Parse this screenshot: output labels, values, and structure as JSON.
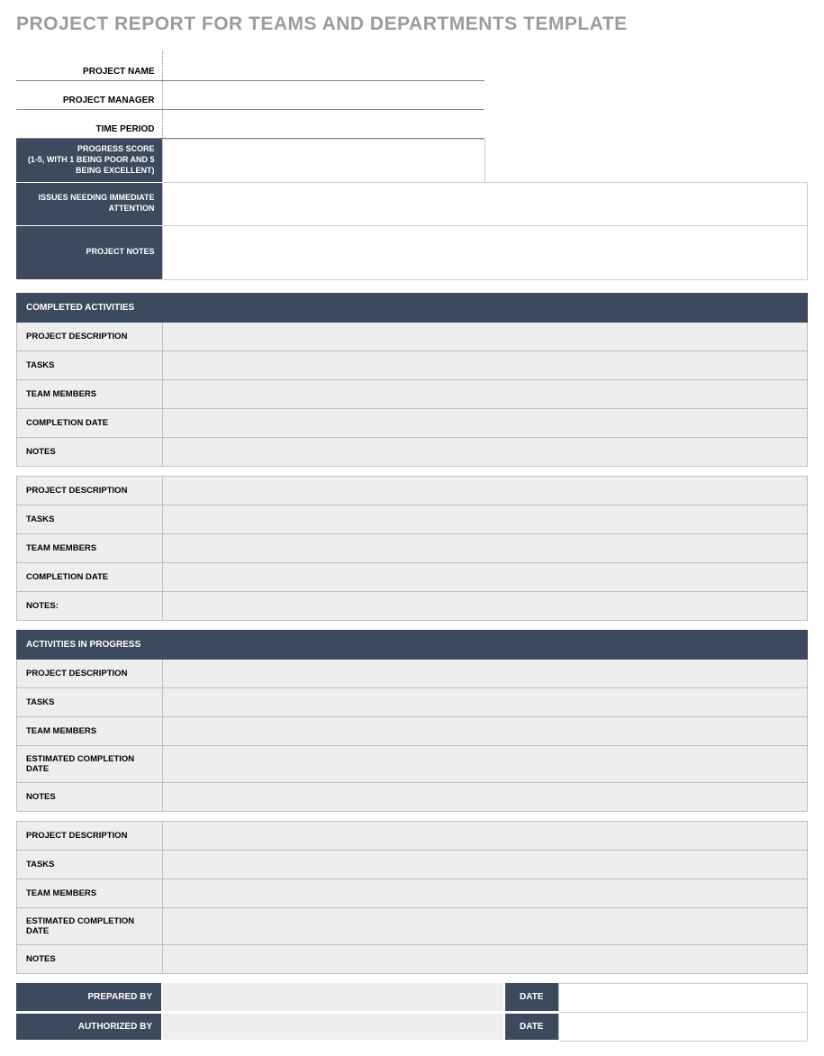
{
  "title": "PROJECT REPORT FOR TEAMS AND DEPARTMENTS TEMPLATE",
  "info": {
    "project_name_label": "PROJECT NAME",
    "project_name_value": "",
    "project_manager_label": "PROJECT MANAGER",
    "project_manager_value": "",
    "time_period_label": "TIME PERIOD",
    "time_period_value": ""
  },
  "dark": {
    "progress_label": "PROGRESS SCORE\n(1-5, WITH 1 BEING POOR AND 5 BEING EXCELLENT)",
    "progress_value": "",
    "issues_label": "ISSUES NEEDING IMMEDIATE ATTENTION",
    "issues_value": "",
    "notes_label": "PROJECT NOTES",
    "notes_value": ""
  },
  "sections": {
    "completed_header": "COMPLETED ACTIVITIES",
    "inprogress_header": "ACTIVITIES IN PROGRESS"
  },
  "completed": [
    {
      "project_description_label": "PROJECT DESCRIPTION",
      "project_description_value": "",
      "tasks_label": "TASKS",
      "tasks_value": "",
      "team_members_label": "TEAM MEMBERS",
      "team_members_value": "",
      "completion_date_label": "COMPLETION DATE",
      "completion_date_value": "",
      "notes_label": "NOTES",
      "notes_value": ""
    },
    {
      "project_description_label": "PROJECT DESCRIPTION",
      "project_description_value": "",
      "tasks_label": "TASKS",
      "tasks_value": "",
      "team_members_label": "TEAM MEMBERS",
      "team_members_value": "",
      "completion_date_label": "COMPLETION DATE",
      "completion_date_value": "",
      "notes_label": "NOTES:",
      "notes_value": ""
    }
  ],
  "inprogress": [
    {
      "project_description_label": "PROJECT DESCRIPTION",
      "project_description_value": "",
      "tasks_label": "TASKS",
      "tasks_value": "",
      "team_members_label": "TEAM MEMBERS",
      "team_members_value": "",
      "est_completion_label": "ESTIMATED COMPLETION DATE",
      "est_completion_value": "",
      "notes_label": "NOTES",
      "notes_value": ""
    },
    {
      "project_description_label": "PROJECT DESCRIPTION",
      "project_description_value": "",
      "tasks_label": "TASKS",
      "tasks_value": "",
      "team_members_label": "TEAM MEMBERS",
      "team_members_value": "",
      "est_completion_label": "ESTIMATED COMPLETION DATE",
      "est_completion_value": "",
      "notes_label": "NOTES",
      "notes_value": ""
    }
  ],
  "signoff": {
    "prepared_by_label": "PREPARED BY",
    "prepared_by_value": "",
    "prepared_date_label": "DATE",
    "prepared_date_value": "",
    "authorized_by_label": "AUTHORIZED BY",
    "authorized_by_value": "",
    "authorized_date_label": "DATE",
    "authorized_date_value": ""
  }
}
